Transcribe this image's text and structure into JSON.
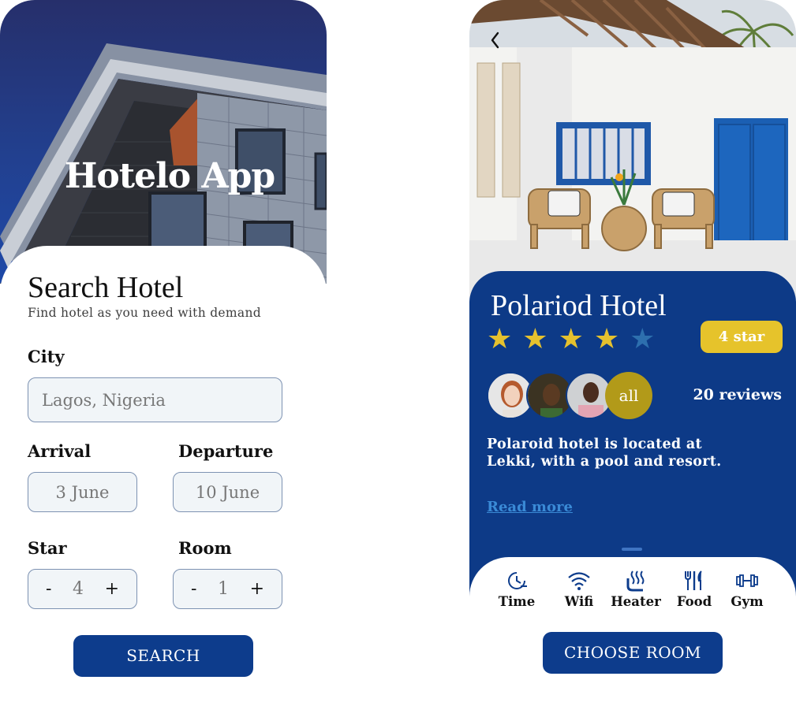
{
  "search_screen": {
    "app_title": "Hotelo App",
    "heading": "Search Hotel",
    "subheading": "Find hotel as you need with demand",
    "city_label": "City",
    "city_value": "Lagos, Nigeria",
    "arrival_label": "Arrival",
    "arrival_value": "3 June",
    "departure_label": "Departure",
    "departure_value": "10 June",
    "star_label": "Star",
    "star_value": "4",
    "room_label": "Room",
    "room_value": "1",
    "minus": "-",
    "plus": "+",
    "search_button": "SEARCH"
  },
  "detail_screen": {
    "hotel_name": "Polariod Hotel",
    "rating": 4,
    "max_rating": 5,
    "star_glyph": "★",
    "star_badge": "4 star",
    "avatars_all_label": "all",
    "reviews": "20 reviews",
    "description": "Polaroid hotel is located at Lekki, with a pool and resort.",
    "read_more": "Read more",
    "amenities": [
      {
        "label": "Time",
        "icon": "clock-icon"
      },
      {
        "label": "Wifi",
        "icon": "wifi-icon"
      },
      {
        "label": "Heater",
        "icon": "heater-icon"
      },
      {
        "label": "Food",
        "icon": "cutlery-icon"
      },
      {
        "label": "Gym",
        "icon": "dumbbell-icon"
      }
    ],
    "choose_button": "CHOOSE ROOM"
  },
  "colors": {
    "primary_blue": "#0d3c8c",
    "panel_blue": "#0d3a87",
    "gold": "#e6c32b",
    "star_inactive": "#2d6fae",
    "link_blue": "#3a8ad6"
  }
}
